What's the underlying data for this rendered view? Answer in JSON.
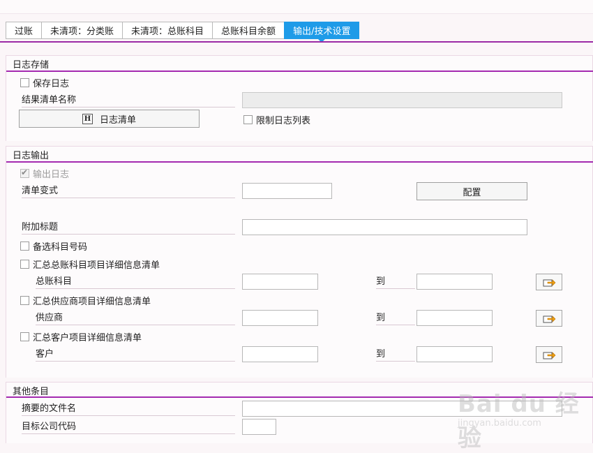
{
  "tabs": [
    {
      "label": "过账",
      "active": false
    },
    {
      "label": "未清项：分类账",
      "active": false
    },
    {
      "label": "未清项：总账科目",
      "active": false
    },
    {
      "label": "总账科目余额",
      "active": false
    },
    {
      "label": "输出/技术设置",
      "active": true
    }
  ],
  "log_storage": {
    "title": "日志存储",
    "save_log_label": "保存日志",
    "save_log_checked": false,
    "result_list_name_label": "结果清单名称",
    "result_list_name_value": "",
    "log_list_button": "日志清单",
    "restrict_log_list_label": "限制日志列表",
    "restrict_log_list_checked": false
  },
  "log_output": {
    "title": "日志输出",
    "output_log_label": "输出日志",
    "output_log_checked": true,
    "list_variant_label": "清单变式",
    "list_variant_value": "",
    "configure_button": "配置",
    "additional_title_label": "附加标题",
    "additional_title_value": "",
    "alt_account_label": "备选科目号码",
    "summary_gl_label": "汇总总账科目项目详细信息清单",
    "gl_account_label": "总账科目",
    "summary_vendor_label": "汇总供应商项目详细信息清单",
    "vendor_label": "供应商",
    "summary_customer_label": "汇总客户项目详细信息清单",
    "customer_label": "客户",
    "to_label": "到"
  },
  "other": {
    "title": "其他条目",
    "summary_file_label": "摘要的文件名",
    "target_company_label": "目标公司代码"
  },
  "watermark": {
    "logo": "Bai du 经验",
    "url": "jingyan.baidu.com"
  },
  "colors": {
    "accent_tab": "#1e9be8",
    "rule": "#a42ab0"
  }
}
